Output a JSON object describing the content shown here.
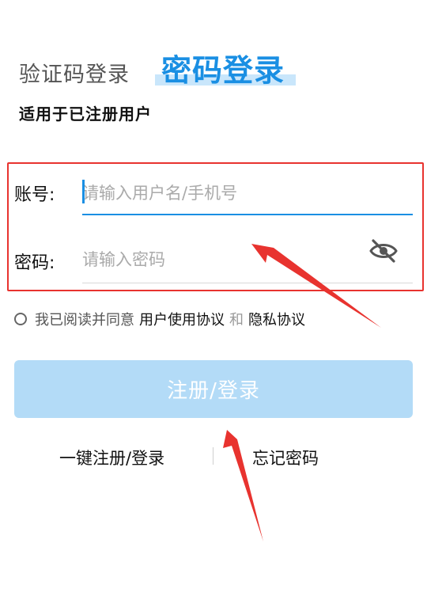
{
  "tabs": {
    "sms_login": "验证码登录",
    "password_login": "密码登录"
  },
  "subtitle": "适用于已注册用户",
  "form": {
    "account_label": "账号:",
    "account_placeholder": "请输入用户名/手机号",
    "account_value": "",
    "password_label": "密码:",
    "password_placeholder": "请输入密码",
    "password_value": ""
  },
  "agreement": {
    "prefix": "我已阅读并同意",
    "user_agreement": "用户使用协议",
    "and": "和",
    "privacy_agreement": "隐私协议",
    "checked": false
  },
  "buttons": {
    "login": "注册/登录",
    "quick_login": "一键注册/登录",
    "forgot_password": "忘记密码"
  },
  "icons": {
    "password_toggle": "eye-off-icon",
    "agree_radio": "radio-unchecked-icon"
  },
  "colors": {
    "accent": "#1a8fe3",
    "button_disabled": "#b3dbf7",
    "annotation_red": "#e8332f"
  }
}
